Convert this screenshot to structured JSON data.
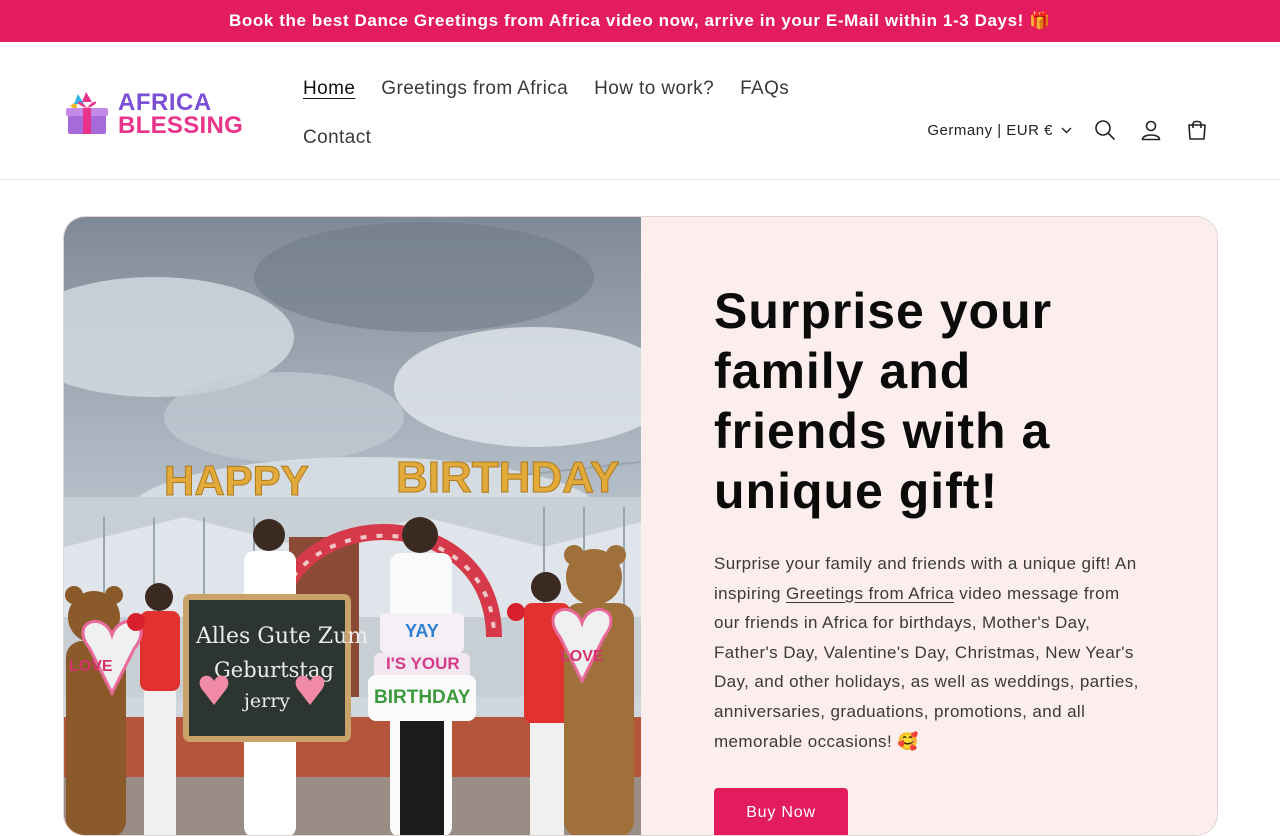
{
  "announcement": {
    "text": "Book the best Dance Greetings from Africa video now, arrive in your E-Mail within 1-3 Days! 🎁"
  },
  "logo": {
    "line1": "AFRICA",
    "line2": "BLESSING"
  },
  "nav": {
    "items": [
      {
        "label": "Home"
      },
      {
        "label": "Greetings from Africa"
      },
      {
        "label": "How to work?"
      },
      {
        "label": "FAQs"
      },
      {
        "label": "Contact"
      }
    ]
  },
  "header": {
    "localization": "Germany | EUR €"
  },
  "hero": {
    "image_text": {
      "happy": "HAPPY",
      "birthday": "BIRTHDAY",
      "board_line1": "Alles Gute Zum",
      "board_line2": "Geburtstag",
      "board_line3": "jerry",
      "cake_line1": "YAY",
      "cake_line2": "I'S YOUR",
      "cake_line3": "BIRTHDAY",
      "love_left": "LOVE",
      "love_right": "LOVE"
    },
    "title": "Surprise your family and friends with a unique gift!",
    "body_intro": "Surprise your family and friends with a unique gift! An inspiring ",
    "body_link": "Greetings from Africa",
    "body_rest": " video message from our friends in Africa for birthdays, Mother's Day, Father's Day, Valentine's Day, Christmas, New Year's Day, and other holidays, as well as weddings, parties, anniversaries, graduations, promotions, and all memorable occasions! 🥰",
    "cta_label": "Buy Now"
  },
  "colors": {
    "brand": "#e31c5f",
    "hero_bg": "#fdeeee",
    "logo_purple": "#7b4fd6",
    "logo_pink": "#e8348a"
  }
}
